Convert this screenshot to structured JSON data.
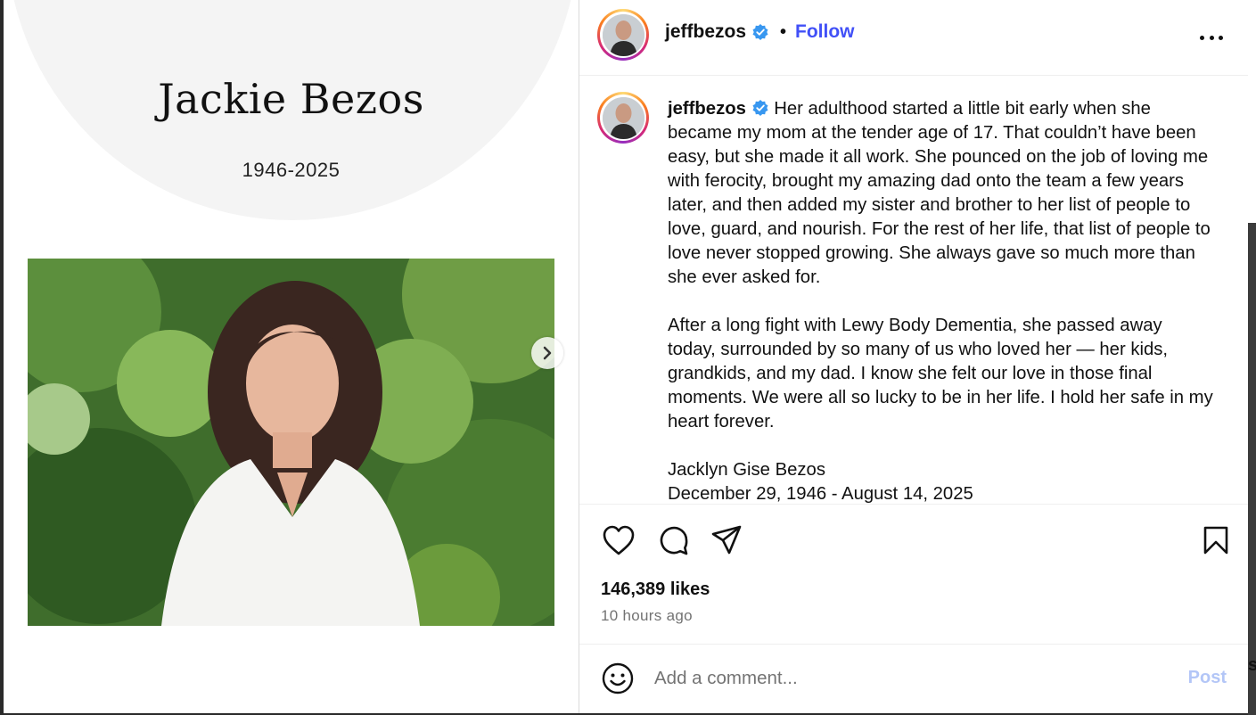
{
  "colors": {
    "accent": "#4150f7",
    "verified": "#3897f0",
    "post_disabled": "#b3c6f7",
    "muted": "#737373"
  },
  "media": {
    "name": "Jackie Bezos",
    "years": "1946-2025",
    "next_icon": "chevron-right-icon"
  },
  "header": {
    "username": "jeffbezos",
    "separator": "•",
    "follow_label": "Follow",
    "more_icon": "more-options-icon"
  },
  "caption": {
    "username": "jeffbezos",
    "paragraph1": "Her adulthood started a little bit early when she became my mom at the tender age of 17. That couldn’t have been easy, but she made it all work. She pounced on the job of loving me with ferocity, brought my amazing dad onto the team a few years later, and then added my sister and brother to her list of people to love, guard, and nourish. For the rest of her life, that list of people to love never stopped growing. She always gave so much more than she ever asked for.",
    "paragraph2": "After a long fight with Lewy Body Dementia, she passed away today, surrounded by so many of us who loved her — her kids, grandkids, and my dad. I know she felt our love in those final moments. We were all so lucky to be in her life. I hold her safe in my heart forever.",
    "sign_name": "Jacklyn Gise Bezos",
    "sign_dates": "December 29, 1946 - August 14, 2025"
  },
  "actions": {
    "like_icon": "heart-icon",
    "comment_icon": "comment-icon",
    "share_icon": "share-icon",
    "save_icon": "bookmark-icon",
    "likes": "146,389 likes",
    "time": "10 hours ago"
  },
  "comment": {
    "emoji_icon": "emoji-icon",
    "placeholder": "Add a comment...",
    "post_label": "Post"
  },
  "edge_text": "s"
}
